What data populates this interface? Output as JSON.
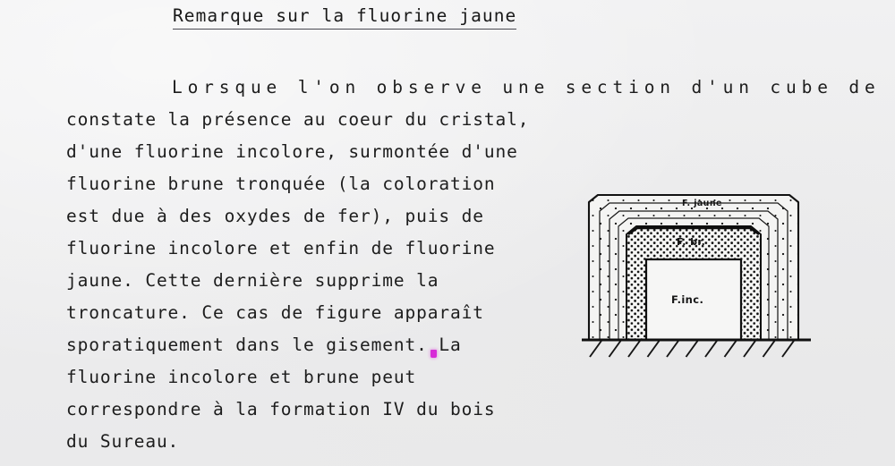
{
  "document": {
    "title": "Remarque sur la fluorine jaune",
    "language": "fr",
    "background_color": "#eeeeef",
    "ink_color": "#1b1b1b",
    "body_lines": [
      "Lorsque l'on observe une section d'un cube de fluorine jaune, on",
      "constate la présence au coeur du cristal,",
      "d'une fluorine incolore, surmontée d'une",
      "fluorine brune tronquée (la coloration",
      "est due à des oxydes de fer), puis de",
      "fluorine incolore et enfin de fluorine",
      "jaune. Cette dernière supprime la",
      "troncature. Ce cas de figure apparaît",
      "sporatiquement dans le gisement. La",
      "fluorine incolore et brune peut",
      "correspondre à la formation IV du bois",
      "du Sureau."
    ]
  },
  "artifacts": {
    "ink_speck_color": "#d61ad6",
    "ink_speck_name": "pink-ink-speck"
  },
  "diagram": {
    "caption_name": "fluorite-cross-section",
    "description": "Coupe d'un cube de fluorine jaune posé sur le sol hachuré",
    "zones": [
      {
        "key": "yellow",
        "label": "F. jaune",
        "fill": "sparse-dots",
        "order": 1
      },
      {
        "key": "brown",
        "label": "F. br.",
        "fill": "dense-dots",
        "order": 2
      },
      {
        "key": "colorless",
        "label": "F.inc.",
        "fill": "blank",
        "order": 3
      }
    ],
    "labels": {
      "outer": "F. jaune",
      "middle": "F. br.",
      "inner": "F.inc."
    },
    "ground": {
      "name": "ground-hatching",
      "hatch_count": 11
    },
    "stroke_color": "#121212"
  }
}
